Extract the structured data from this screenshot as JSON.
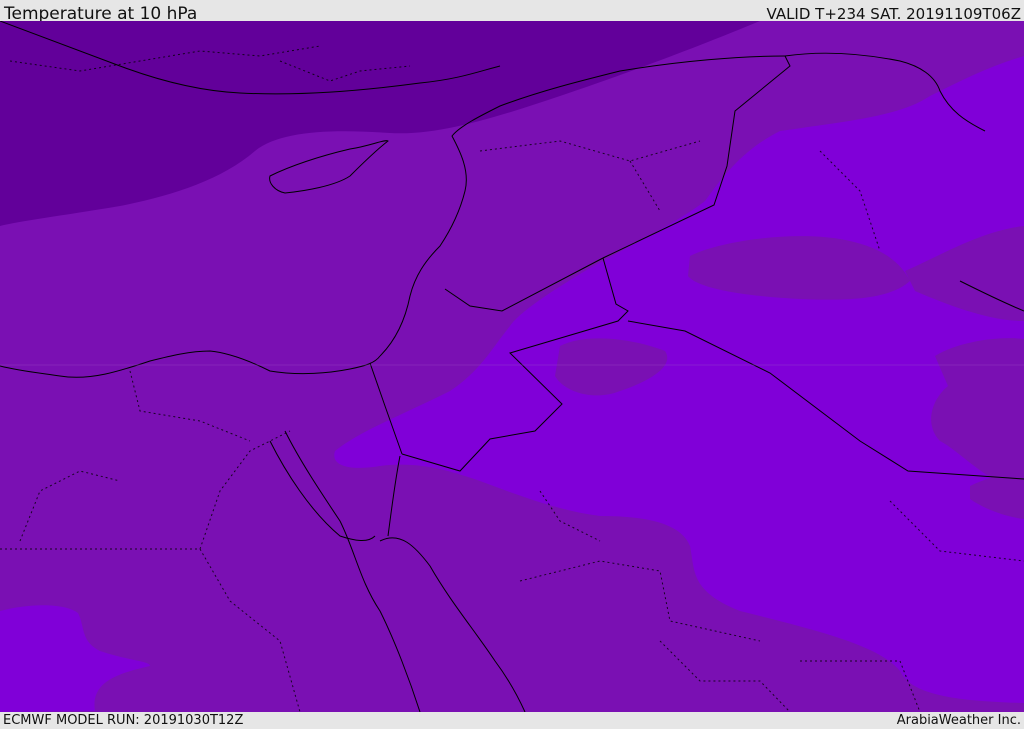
{
  "header": {
    "title": "Temperature at 10 hPa",
    "valid_time": "VALID T+234 SAT. 20191109T06Z"
  },
  "footer": {
    "model_run": "ECMWF MODEL RUN: 20191030T12Z",
    "credit": "ArabiaWeather Inc."
  },
  "map": {
    "field": "temperature",
    "pressure_level": "10 hPa",
    "colors": {
      "coldest": "#62009a",
      "mid": "#7a10b3",
      "warm": "#8000d8",
      "boundary": "#000000"
    }
  }
}
